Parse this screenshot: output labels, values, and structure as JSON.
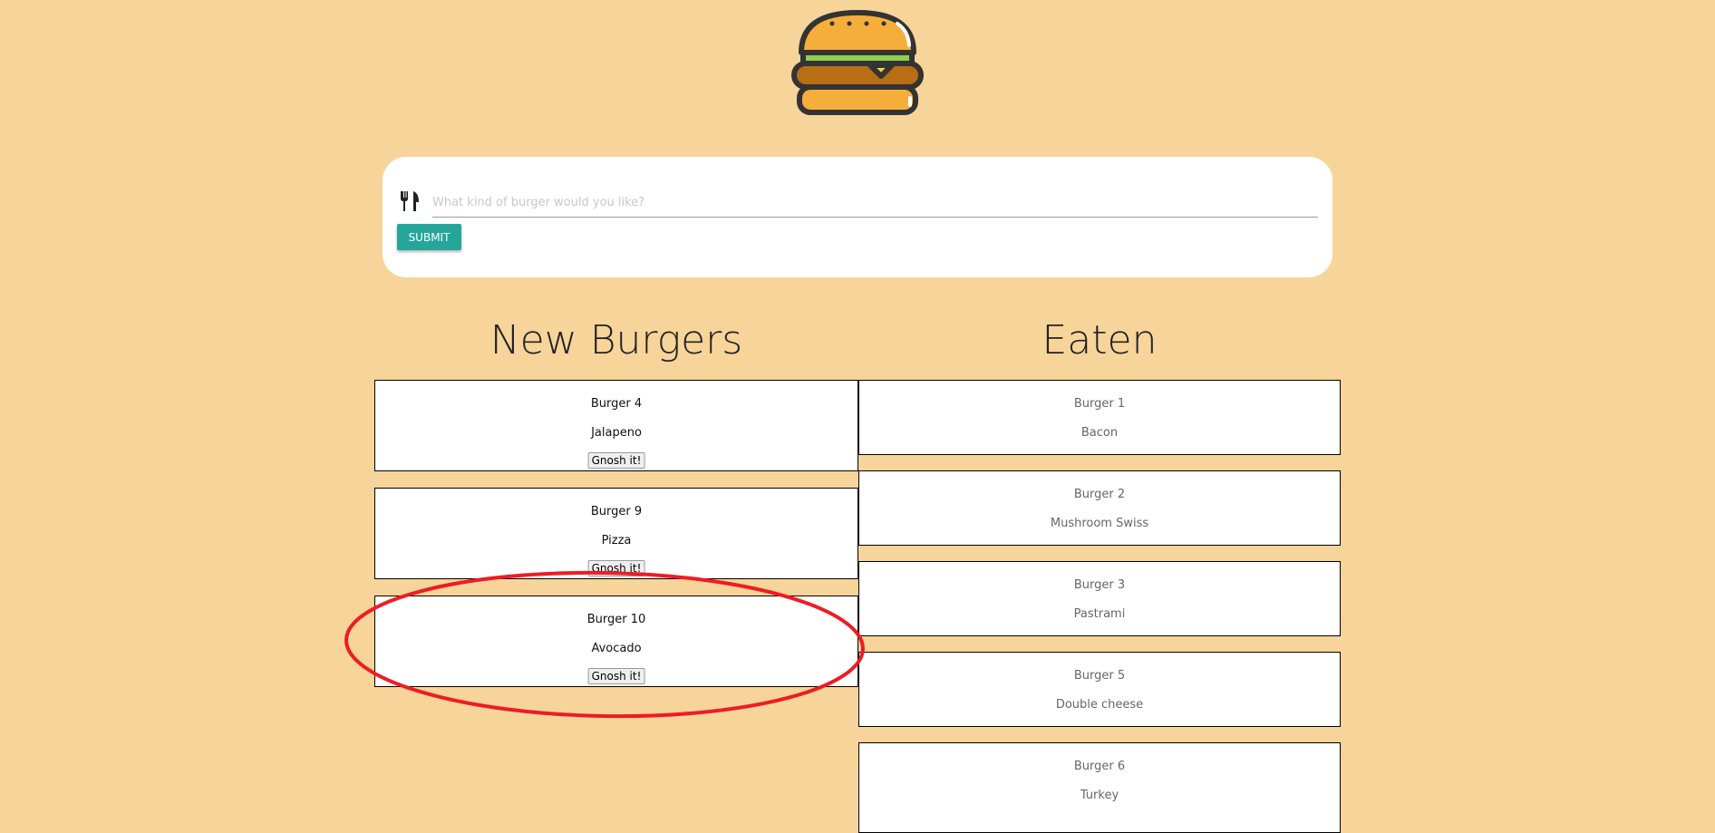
{
  "logo": {
    "icon": "burger-logo-icon"
  },
  "form": {
    "icon": "fork-knife-icon",
    "placeholder": "What kind of burger would you like?",
    "value": "",
    "submit_label": "SUBMIT",
    "accent": "#26a69a"
  },
  "new_burgers": {
    "title": "New Burgers",
    "items": [
      {
        "name": "Burger 4",
        "type": "Jalapeno",
        "button": "Gnosh it!"
      },
      {
        "name": "Burger 9",
        "type": "Pizza",
        "button": "Gnosh it!"
      },
      {
        "name": "Burger 10",
        "type": "Avocado",
        "button": "Gnosh it!"
      }
    ]
  },
  "eaten": {
    "title": "Eaten",
    "items": [
      {
        "name": "Burger 1",
        "type": "Bacon"
      },
      {
        "name": "Burger 2",
        "type": "Mushroom Swiss"
      },
      {
        "name": "Burger 3",
        "type": "Pastrami"
      },
      {
        "name": "Burger 5",
        "type": "Double cheese"
      },
      {
        "name": "Burger 6",
        "type": "Turkey"
      }
    ]
  },
  "annotation": {
    "shape": "ellipse",
    "color": "#ee1c24",
    "target": "Burger 10"
  }
}
